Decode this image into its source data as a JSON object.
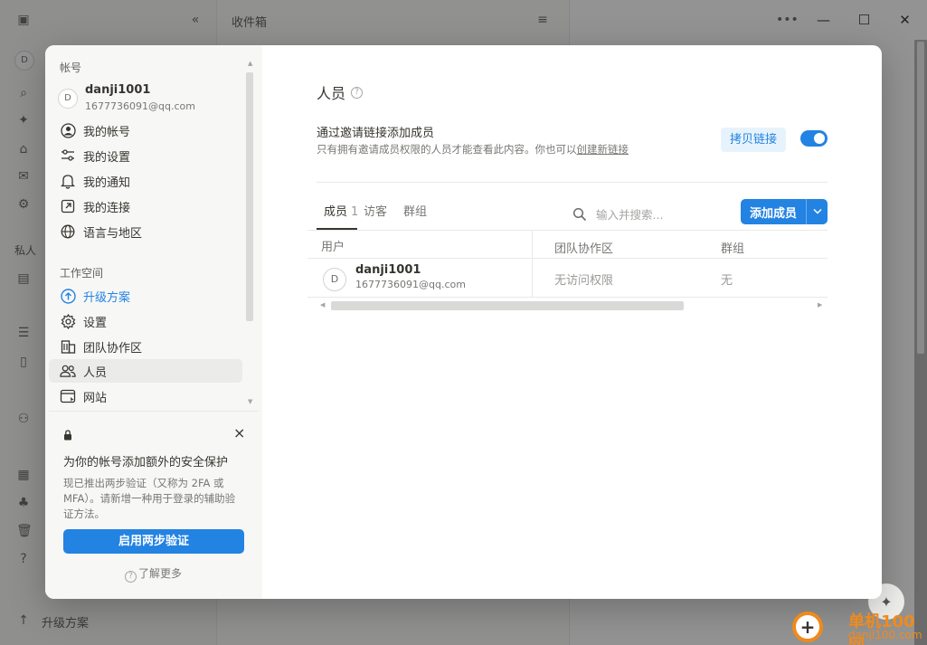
{
  "background": {
    "inbox_title": "收件箱",
    "sidebar_workspace_initial": "D",
    "sidebar_section_private": "私人",
    "upgrade_label": "升级方案"
  },
  "window": {
    "minimize": "—",
    "maximize": "☐",
    "close": "✕"
  },
  "settings": {
    "account_section": "帐号",
    "user": {
      "initial": "D",
      "name": "danji1001",
      "email": "1677736091@qq.com"
    },
    "account_items": [
      {
        "label": "我的帐号",
        "icon": "user-circle-icon"
      },
      {
        "label": "我的设置",
        "icon": "sliders-icon"
      },
      {
        "label": "我的通知",
        "icon": "bell-icon"
      },
      {
        "label": "我的连接",
        "icon": "external-link-icon"
      },
      {
        "label": "语言与地区",
        "icon": "globe-icon"
      }
    ],
    "workspace_section": "工作空间",
    "workspace_items": [
      {
        "label": "升级方案",
        "icon": "arrow-up-circle-icon"
      },
      {
        "label": "设置",
        "icon": "gear-icon"
      },
      {
        "label": "团队协作区",
        "icon": "building-icon"
      },
      {
        "label": "人员",
        "icon": "people-icon"
      },
      {
        "label": "网站",
        "icon": "browser-icon"
      }
    ],
    "promo": {
      "title": "为你的帐号添加额外的安全保护",
      "description": "现已推出两步验证（又称为 2FA 或 MFA）。请新增一种用于登录的辅助验证方法。",
      "button": "启用两步验证",
      "learn_more": "了解更多"
    }
  },
  "people": {
    "title": "人员",
    "invite_title": "通过邀请链接添加成员",
    "invite_desc_prefix": "只有拥有邀请成员权限的人员才能查看此内容。你也可以",
    "invite_desc_link": "创建新链接",
    "copy_link": "拷贝链接",
    "invite_link_enabled": true,
    "tabs": [
      {
        "label": "成员",
        "count": "1",
        "active": true
      },
      {
        "label": "访客",
        "active": false
      },
      {
        "label": "群组",
        "active": false
      }
    ],
    "search_placeholder": "输入并搜索...",
    "add_member": "添加成员",
    "columns": [
      "用户",
      "团队协作区",
      "群组"
    ],
    "rows": [
      {
        "initial": "D",
        "name": "danji1001",
        "email": "1677736091@qq.com",
        "teamspace": "无访问权限",
        "group": "无"
      }
    ]
  },
  "watermark": {
    "title": "单机100网",
    "url": "danji100.com"
  },
  "colors": {
    "accent": "#2383e2",
    "accent_light": "#e7f3fc",
    "sidebar_bg": "#f7f7f5",
    "watermark": "#f08a1c"
  }
}
